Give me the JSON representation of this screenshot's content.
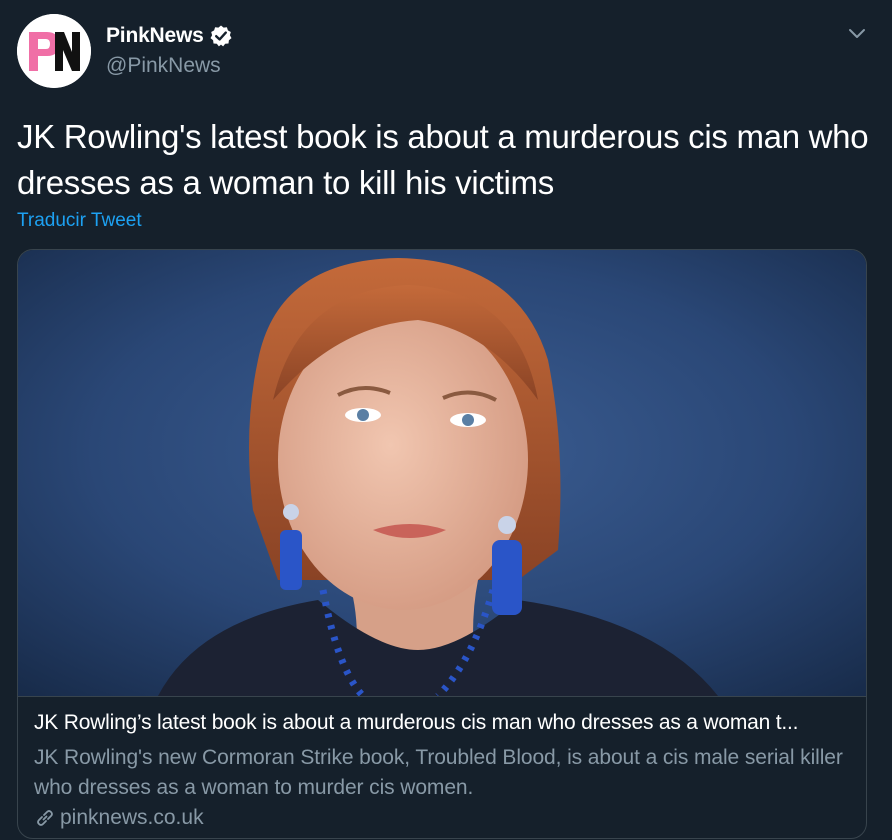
{
  "account": {
    "display_name": "PinkNews",
    "handle": "@PinkNews",
    "avatar_initials": "PN",
    "verified": true
  },
  "tweet": {
    "text": "JK Rowling's latest book is about a murderous cis man who dresses as a woman to kill his victims",
    "translate_label": "Traducir Tweet"
  },
  "card": {
    "title": "JK Rowling’s latest book is about a murderous cis man who dresses as a woman t...",
    "description": "JK Rowling's new Cormoran Strike book, Troubled Blood, is about a cis male serial killer who dresses as a woman to murder cis women.",
    "domain": "pinknews.co.uk"
  },
  "icons": {
    "verified": "verified-badge-icon",
    "caret": "chevron-down-icon",
    "link": "link-icon"
  },
  "colors": {
    "background": "#15202b",
    "accent": "#1da1f2",
    "secondary_text": "#8899a6",
    "border": "#38444d",
    "brand_pink": "#f06fa6"
  }
}
